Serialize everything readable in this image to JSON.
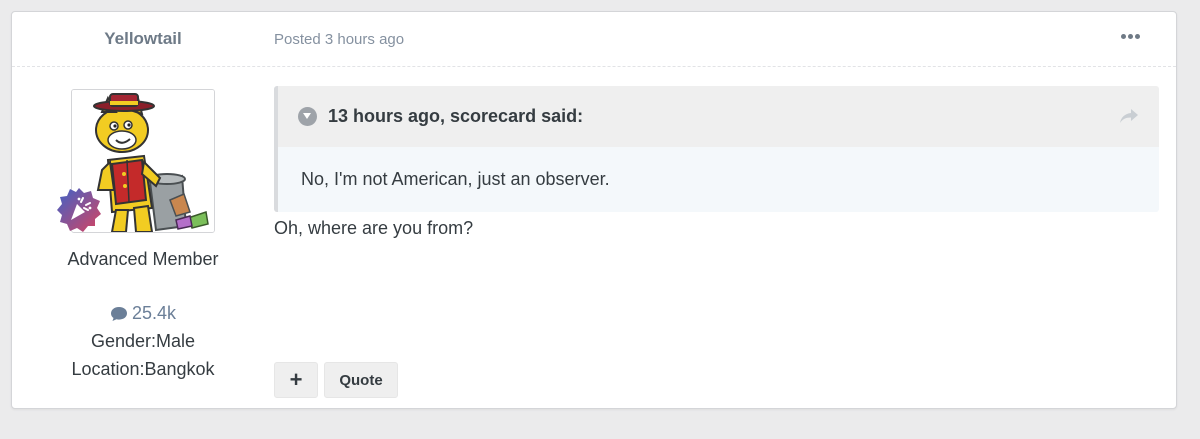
{
  "post": {
    "author": "Yellowtail",
    "posted": "Posted 3 hours ago",
    "member_title": "Advanced Member",
    "post_count": "25.4k",
    "gender": "Gender:Male",
    "location": "Location:Bangkok",
    "quote": {
      "citation": "13 hours ago, scorecard said:",
      "text": "No, I'm not American, just an observer."
    },
    "text": "Oh, where are you from?",
    "actions": {
      "plus_label": "+",
      "quote_label": "Quote"
    }
  },
  "icons": {
    "more": "more-options-icon",
    "comment": "comment-bubble-icon",
    "quote_toggle": "chevron-down-icon",
    "share": "share-arrow-icon",
    "badge": "celebration-badge-icon"
  },
  "colors": {
    "accent": "#6b7f98",
    "page_bg": "#ebebec",
    "quote_bg": "#f4f8fb",
    "quote_head_bg": "#efefef"
  }
}
